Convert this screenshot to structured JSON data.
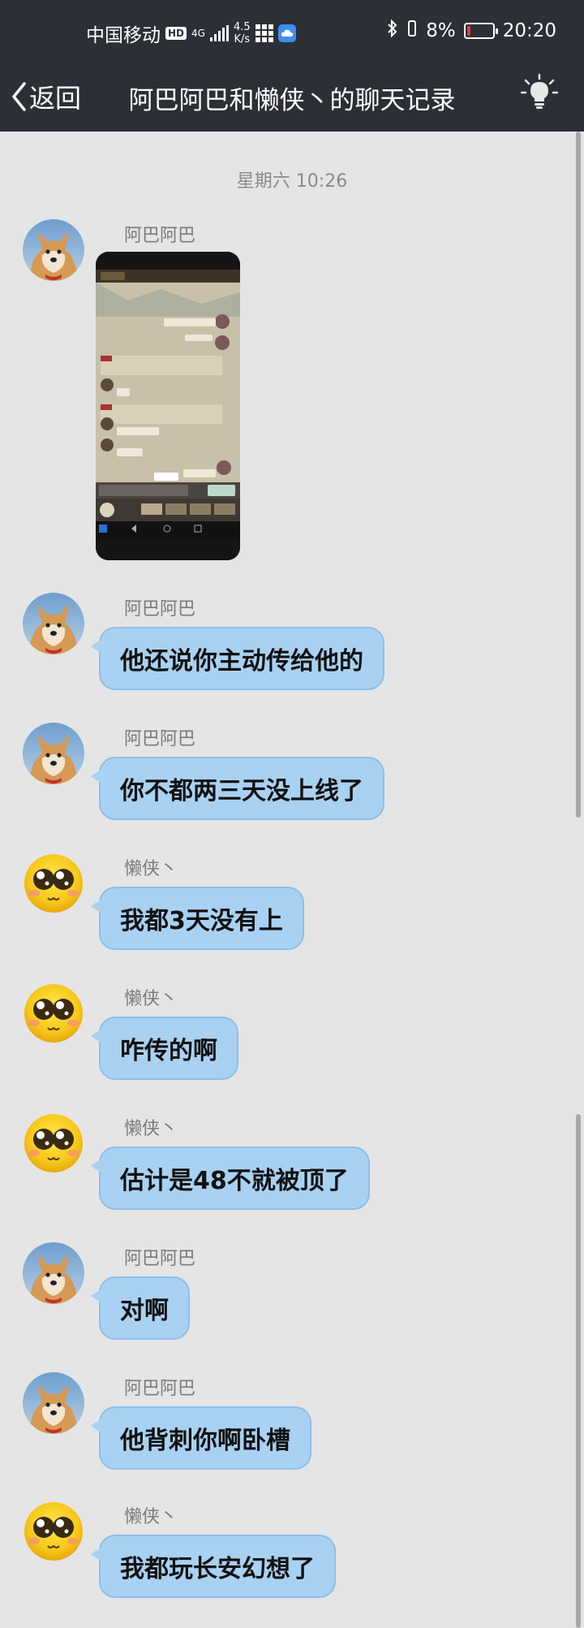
{
  "status_bar": {
    "carrier": "中国移动",
    "hd_badge": "HD",
    "network_tag": "4G",
    "speed_value": "4.5",
    "speed_unit": "K/s",
    "battery": "8%",
    "time": "20:20"
  },
  "header": {
    "back_label": "返回",
    "title": "阿巴阿巴和懒侠丶的聊天记录"
  },
  "timestamp": "星期六 10:26",
  "messages": [
    {
      "sender": "阿巴阿巴",
      "type": "image"
    },
    {
      "sender": "阿巴阿巴",
      "text": "他还说你主动传给他的"
    },
    {
      "sender": "阿巴阿巴",
      "text": "你不都两三天没上线了"
    },
    {
      "sender": "懒侠丶",
      "text": "我都3天没有上"
    },
    {
      "sender": "懒侠丶",
      "text": "咋传的啊"
    },
    {
      "sender": "懒侠丶",
      "text": "估计是48不就被顶了"
    },
    {
      "sender": "阿巴阿巴",
      "text": "对啊"
    },
    {
      "sender": "阿巴阿巴",
      "text": "他背刺你啊卧槽"
    },
    {
      "sender": "懒侠丶",
      "text": "我都玩长安幻想了"
    }
  ],
  "colors": {
    "header_bg": "#2c2f36",
    "chat_bg": "#e5e5e5",
    "bubble": "#a9d1f2",
    "battery_low": "#e23b3b"
  },
  "icons": {
    "back": "chevron-left-icon",
    "bulb": "lightbulb-icon",
    "shiba_avatar": "shiba-dog-avatar",
    "emoji_avatar": "blushing-emoji-avatar"
  }
}
